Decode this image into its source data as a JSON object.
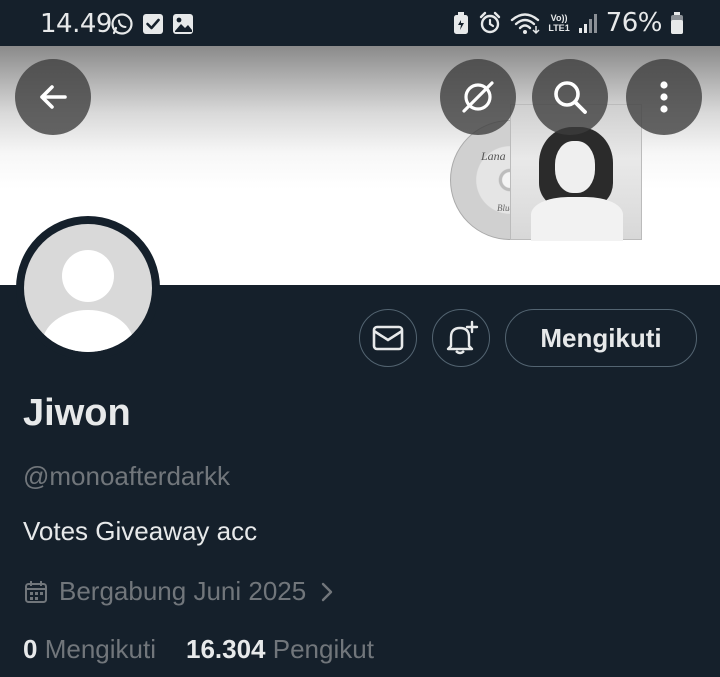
{
  "status_bar": {
    "time": "14.49",
    "left_icons": [
      "whatsapp-icon",
      "checkbox-notification-icon",
      "gallery-icon"
    ],
    "right_icons": [
      "battery-saver-icon",
      "alarm-icon",
      "wifi-icon",
      "volte-lte-icon",
      "signal-icon",
      "battery-icon"
    ],
    "lte_label_top": "Vo))",
    "lte_label_bottom": "LTE1",
    "battery": "76%"
  },
  "banner": {
    "cd_label": "Lana",
    "cd_label_bottom": "Blue"
  },
  "header_buttons": [
    "back-icon",
    "grok-icon",
    "search-icon",
    "more-vertical-icon"
  ],
  "profile": {
    "name": "Jiwon",
    "handle": "@monoafterdarkk",
    "bio": "Votes Giveaway acc",
    "joined": "Bergabung Juni 2025",
    "following_count": "0",
    "following_label": "Mengikuti",
    "followers_count": "16.304",
    "followers_label": "Pengikut"
  },
  "actions": {
    "follow_button": "Mengikuti",
    "message_icon": "mail-icon",
    "notify_icon": "bell-plus-icon"
  },
  "colors": {
    "background": "#15202b",
    "text_primary": "#e7e9ea",
    "text_secondary": "#71767b",
    "border": "#536471"
  }
}
